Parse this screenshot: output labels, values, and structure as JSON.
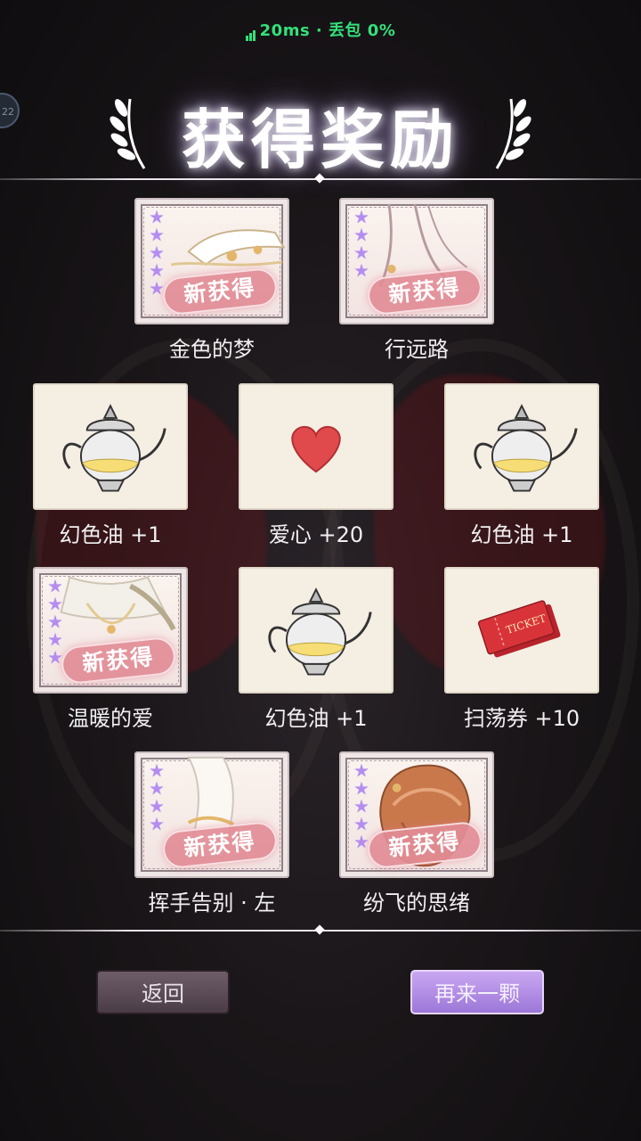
{
  "status": {
    "network": "20ms · 丢包 0%"
  },
  "side_badge": {
    "text": "22"
  },
  "title": "获得奖励",
  "rewards": [
    {
      "name": "金色的梦",
      "stars": 5,
      "new_badge": "新获得",
      "icon": "hand-art"
    },
    {
      "name": "行远路",
      "stars": 4,
      "new_badge": "新获得",
      "icon": "shoe-art"
    },
    {
      "name": "幻色油 +1",
      "icon": "teapot-icon"
    },
    {
      "name": "爱心 +20",
      "icon": "heart-icon"
    },
    {
      "name": "幻色油 +1",
      "icon": "teapot-icon"
    },
    {
      "name": "温暖的爱",
      "stars": 5,
      "new_badge": "新获得",
      "icon": "top-art"
    },
    {
      "name": "幻色油 +1",
      "icon": "teapot-icon"
    },
    {
      "name": "扫荡券 +10",
      "icon": "ticket-icon",
      "ticket_text": "TICKET"
    },
    {
      "name": "挥手告别 · 左",
      "stars": 4,
      "new_badge": "新获得",
      "icon": "sleeve-art"
    },
    {
      "name": "纷飞的思绪",
      "stars": 5,
      "new_badge": "新获得",
      "icon": "hair-art"
    }
  ],
  "buttons": {
    "back": "返回",
    "again": "再来一颗"
  },
  "colors": {
    "star": "#b58cf0",
    "badge": "#e28c96",
    "network": "#33e07a",
    "again_button": "#b08be6"
  }
}
